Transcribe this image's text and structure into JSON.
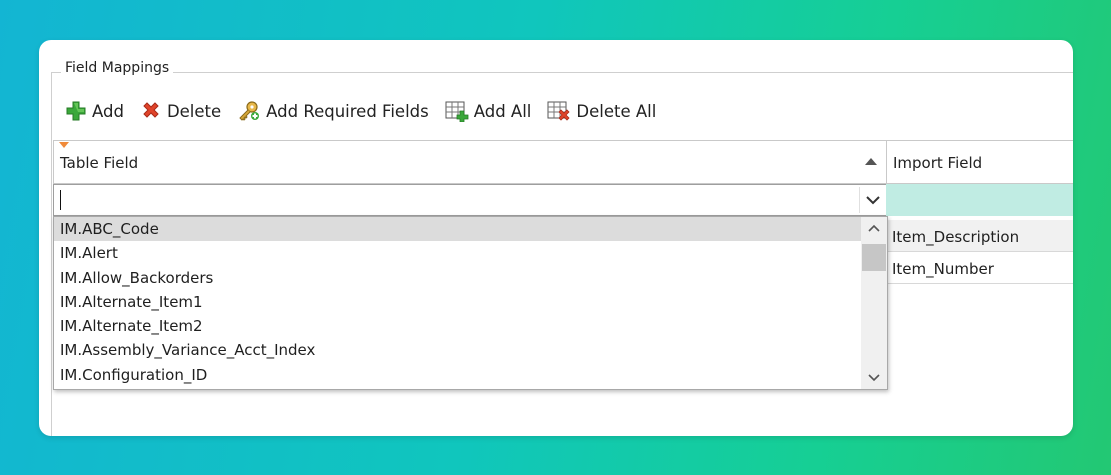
{
  "group": {
    "title": "Field Mappings"
  },
  "toolbar": {
    "add": "Add",
    "delete": "Delete",
    "add_required": "Add Required Fields",
    "add_all": "Add All",
    "delete_all": "Delete All"
  },
  "grid": {
    "columns": {
      "table_field": "Table Field",
      "import_field": "Import Field"
    },
    "edit_value": "",
    "import_rows": [
      "Item_Description",
      "Item_Number"
    ]
  },
  "dropdown": {
    "items": [
      "IM.ABC_Code",
      "IM.Alert",
      "IM.Allow_Backorders",
      "IM.Alternate_Item1",
      "IM.Alternate_Item2",
      "IM.Assembly_Variance_Acct_Index",
      "IM.Configuration_ID"
    ],
    "selected_index": 0
  },
  "colors": {
    "edit_row_highlight": "#c0ece3",
    "selected_item": "#dcdcdc",
    "add_icon": "#3aa83a",
    "delete_icon": "#e0442a"
  },
  "icons": {
    "add": "green-plus-icon",
    "delete": "red-x-icon",
    "add_required": "keys-icon",
    "add_all": "grid-plus-icon",
    "delete_all": "grid-x-icon",
    "sort": "sort-ascending-icon",
    "dropdown": "chevron-down-icon"
  }
}
